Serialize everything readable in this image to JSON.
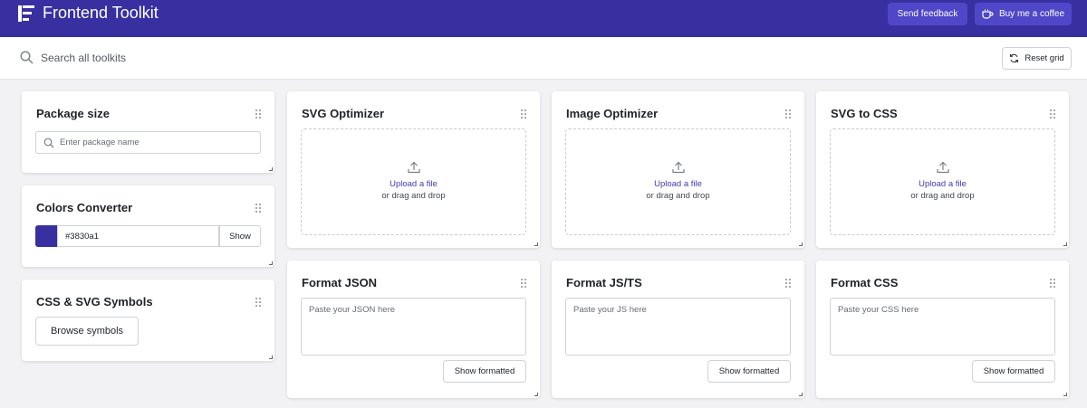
{
  "header": {
    "title": "Frontend Toolkit",
    "send_feedback": "Send feedback",
    "coffee": "Buy me a coffee",
    "bg_color": "#3830a1"
  },
  "search": {
    "placeholder": "Search all toolkits",
    "reset_label": "Reset grid"
  },
  "package_size": {
    "title": "Package size",
    "placeholder": "Enter package name"
  },
  "colors": {
    "title": "Colors Converter",
    "value": "#3830a1",
    "show_label": "Show",
    "swatch": "#3830a1"
  },
  "symbols": {
    "title": "CSS & SVG Symbols",
    "browse_label": "Browse symbols"
  },
  "upload": {
    "link": "Upload a file",
    "sub": "or drag and drop"
  },
  "svg_optimizer": {
    "title": "SVG Optimizer"
  },
  "image_optimizer": {
    "title": "Image Optimizer"
  },
  "svg_to_css": {
    "title": "SVG to CSS"
  },
  "format_json": {
    "title": "Format JSON",
    "placeholder": "Paste your JSON here",
    "button": "Show formatted"
  },
  "format_js": {
    "title": "Format JS/TS",
    "placeholder": "Paste your JS here",
    "button": "Show formatted"
  },
  "format_css": {
    "title": "Format CSS",
    "placeholder": "Paste your CSS here",
    "button": "Show formatted"
  }
}
